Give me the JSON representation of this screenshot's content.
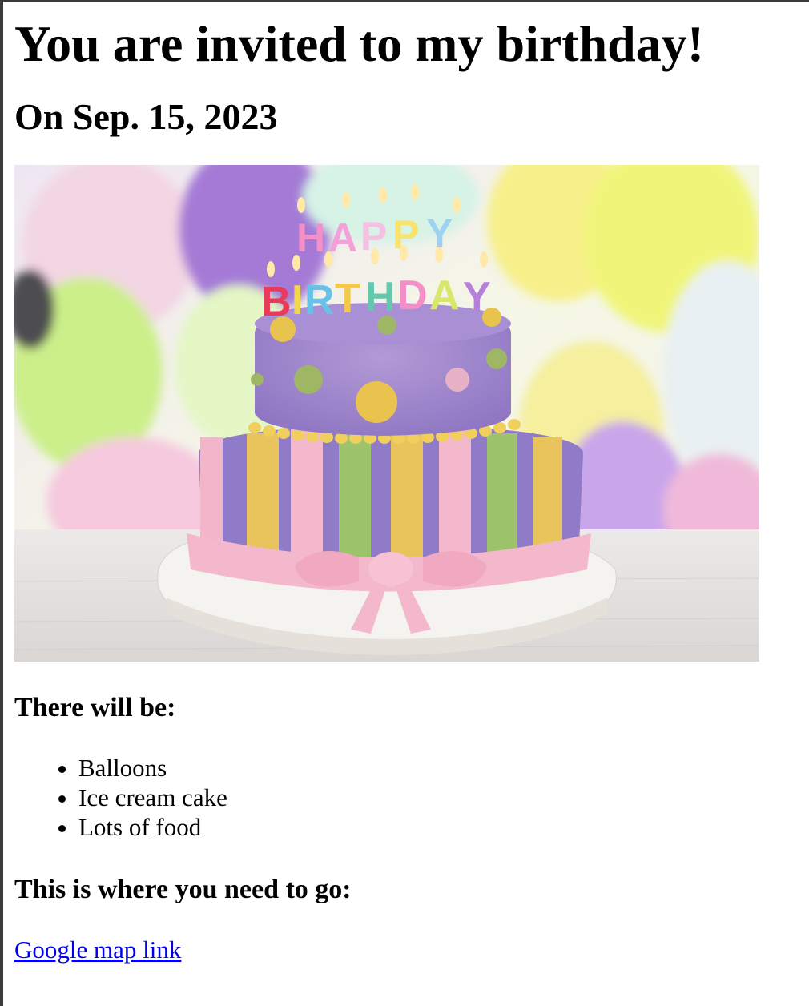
{
  "page": {
    "title": "You are invited to my birthday!",
    "date_heading": "On Sep. 15, 2023",
    "image": {
      "description_icon": "birthday-cake-image",
      "cake_topper": [
        "HAPPY",
        "BIRTHDAY"
      ]
    },
    "there_will_be_heading": "There will be:",
    "items": [
      "Balloons",
      "Ice cream cake",
      "Lots of food"
    ],
    "where_heading": "This is where you need to go:",
    "map_link_label": "Google map link"
  },
  "colors": {
    "link": "#0000ee",
    "text": "#000000",
    "background": "#ffffff"
  }
}
